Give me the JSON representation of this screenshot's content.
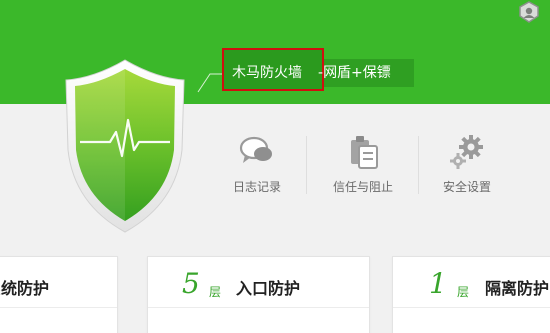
{
  "colors": {
    "header_green": "#3bb82a",
    "accent_green": "#39a52c",
    "highlight_red": "#d00f0f"
  },
  "shield": {
    "icon": "shield-heartbeat-icon"
  },
  "status_tag": {
    "primary": "木马防火墙",
    "dash": "-",
    "secondary": "网盾+保镖"
  },
  "tools": [
    {
      "label": "日志记录",
      "icon": "chat-bubble-icon"
    },
    {
      "label": "信任与阻止",
      "icon": "clipboard-icon"
    },
    {
      "label": "安全设置",
      "icon": "gear-icon"
    }
  ],
  "cards": [
    {
      "title": "系统防护"
    },
    {
      "number": "5",
      "unit": "层",
      "title": "入口防护"
    },
    {
      "number": "1",
      "unit": "层",
      "title": "隔离防护"
    }
  ]
}
